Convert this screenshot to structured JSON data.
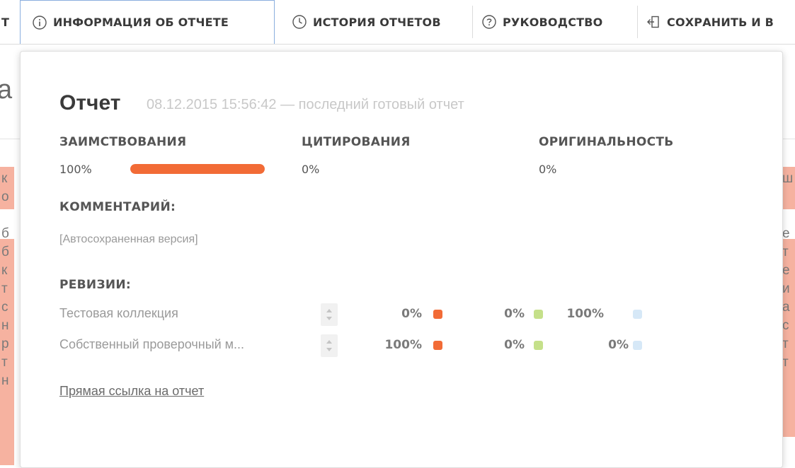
{
  "toolbar": {
    "partial_left": "Т",
    "items": [
      {
        "label": "ИНФОРМАЦИЯ ОБ ОТЧЕТЕ",
        "icon": "info-circle-icon",
        "active": true
      },
      {
        "label": "ИСТОРИЯ ОТЧЕТОВ",
        "icon": "clock-history-icon",
        "active": false
      },
      {
        "label": "РУКОВОДСТВО",
        "icon": "question-circle-icon",
        "active": false
      },
      {
        "label": "СОХРАНИТЬ И В",
        "icon": "save-exit-icon",
        "active": false
      }
    ]
  },
  "background": {
    "heading_fragment": "а",
    "left_letters": "к\nо\n\nб\nб\nк\nт\nс\nн\nр\nт\nн",
    "right_letters": "ш\n\n\nе\nт\nе\nи\nа\nс\nт\nт\n"
  },
  "report": {
    "title": "Отчет",
    "subtitle": "08.12.2015 15:56:42 — последний готовый отчет",
    "metrics": [
      {
        "label": "ЗАИМСТВОВАНИЯ",
        "value": "100%",
        "fraction": 1.0
      },
      {
        "label": "ЦИТИРОВАНИЯ",
        "value": "0%"
      },
      {
        "label": "ОРИГИНАЛЬНОСТЬ",
        "value": "0%"
      }
    ],
    "comment_label": "КОММЕНТАРИЙ:",
    "comment_text": "[Автосохраненная версия]",
    "revisions_label": "РЕВИЗИИ:",
    "revisions": [
      {
        "name": "Тестовая коллекция",
        "borrow": "0%",
        "cite": "0%",
        "original": "100%"
      },
      {
        "name": "Собственный проверочный м...",
        "borrow": "100%",
        "cite": "0%",
        "original": "0%"
      }
    ],
    "direct_link": "Прямая ссылка на отчет"
  },
  "colors": {
    "borrow": "#f26b36",
    "cite": "#c5e08a",
    "original": "#d6e8f7",
    "active_tab_border": "#8aaede"
  }
}
